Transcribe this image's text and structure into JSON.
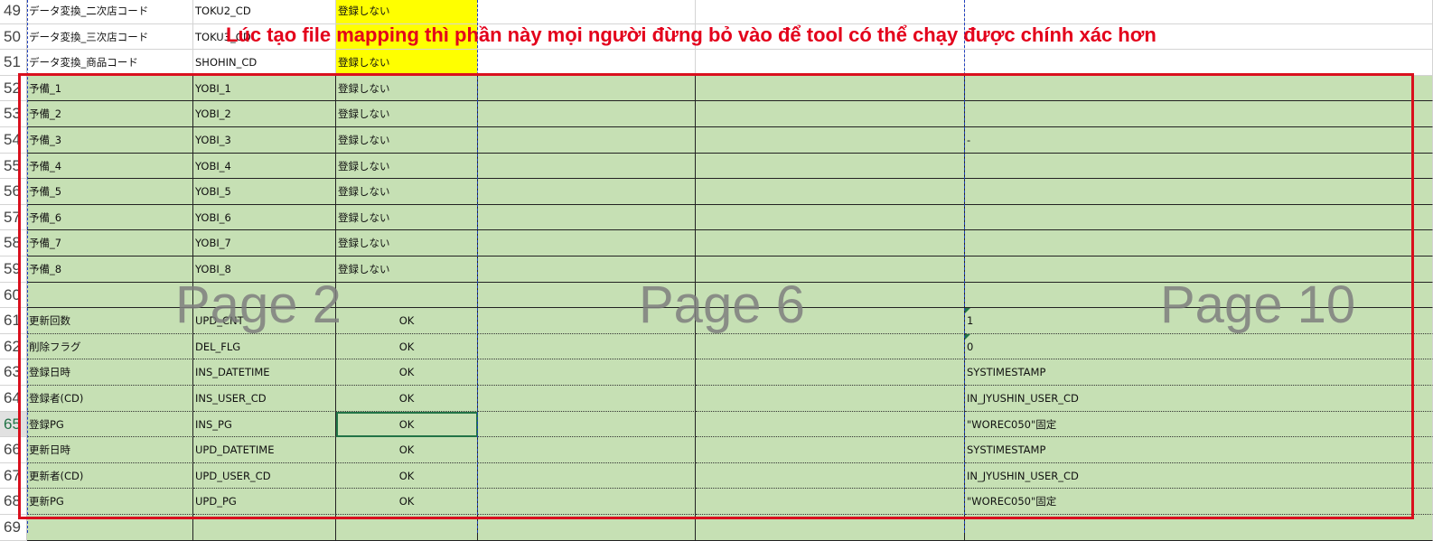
{
  "rows": [
    {
      "num": "49",
      "c1": "データ変換_二次店コード",
      "c2": "TOKU2_CD",
      "c3": "登録しない",
      "c6": "",
      "type": "white",
      "c3yellow": true
    },
    {
      "num": "50",
      "c1": "データ変換_三次店コード",
      "c2": "TOKU3_CD",
      "c3": "",
      "c6": "",
      "type": "white",
      "c3yellow": true
    },
    {
      "num": "51",
      "c1": "データ変換_商品コード",
      "c2": "SHOHIN_CD",
      "c3": "登録しない",
      "c6": "",
      "type": "white",
      "c3yellow": true
    },
    {
      "num": "52",
      "c1": "予備_1",
      "c2": "YOBI_1",
      "c3": "登録しない",
      "c6": "",
      "type": "green"
    },
    {
      "num": "53",
      "c1": "予備_2",
      "c2": "YOBI_2",
      "c3": "登録しない",
      "c6": "",
      "type": "green"
    },
    {
      "num": "54",
      "c1": "予備_3",
      "c2": "YOBI_3",
      "c3": "登録しない",
      "c6": "-",
      "type": "green"
    },
    {
      "num": "55",
      "c1": "予備_4",
      "c2": "YOBI_4",
      "c3": "登録しない",
      "c6": "",
      "type": "green"
    },
    {
      "num": "56",
      "c1": "予備_5",
      "c2": "YOBI_5",
      "c3": "登録しない",
      "c6": "",
      "type": "green"
    },
    {
      "num": "57",
      "c1": "予備_6",
      "c2": "YOBI_6",
      "c3": "登録しない",
      "c6": "",
      "type": "green"
    },
    {
      "num": "58",
      "c1": "予備_7",
      "c2": "YOBI_7",
      "c3": "登録しない",
      "c6": "",
      "type": "green"
    },
    {
      "num": "59",
      "c1": "予備_8",
      "c2": "YOBI_8",
      "c3": "登録しない",
      "c6": "",
      "type": "green"
    },
    {
      "num": "60",
      "c1": "",
      "c2": "",
      "c3": "",
      "c6": "",
      "type": "green"
    },
    {
      "num": "61",
      "c1": "更新回数",
      "c2": "UPD_CNT",
      "c3": "OK",
      "c6": "1",
      "type": "green",
      "dotted": true,
      "tick": true
    },
    {
      "num": "62",
      "c1": "削除フラグ",
      "c2": "DEL_FLG",
      "c3": "OK",
      "c6": "0",
      "type": "green",
      "dotted": true,
      "tick": true
    },
    {
      "num": "63",
      "c1": "登録日時",
      "c2": "INS_DATETIME",
      "c3": "OK",
      "c6": "SYSTIMESTAMP",
      "type": "green",
      "dotted": true
    },
    {
      "num": "64",
      "c1": "登録者(CD)",
      "c2": "INS_USER_CD",
      "c3": "OK",
      "c6": "IN_JYUSHIN_USER_CD",
      "type": "green",
      "dotted": true
    },
    {
      "num": "65",
      "c1": "登録PG",
      "c2": "INS_PG",
      "c3": "OK",
      "c6": "\"WOREC050\"固定",
      "type": "green",
      "dotted": true,
      "selected": true
    },
    {
      "num": "66",
      "c1": "更新日時",
      "c2": "UPD_DATETIME",
      "c3": "OK",
      "c6": "SYSTIMESTAMP",
      "type": "green",
      "dotted": true
    },
    {
      "num": "67",
      "c1": "更新者(CD)",
      "c2": "UPD_USER_CD",
      "c3": "OK",
      "c6": "IN_JYUSHIN_USER_CD",
      "type": "green",
      "dotted": true
    },
    {
      "num": "68",
      "c1": "更新PG",
      "c2": "UPD_PG",
      "c3": "OK",
      "c6": "\"WOREC050\"固定",
      "type": "green",
      "dotted": true
    },
    {
      "num": "69",
      "c1": "",
      "c2": "",
      "c3": "",
      "c6": "",
      "type": "green"
    }
  ],
  "watermarks": {
    "page2": "Page 2",
    "page6": "Page 6",
    "page10": "Page 10"
  },
  "annotation": "Lúc tạo file mapping thì phần này mọi người đừng bỏ vào để tool có thể chạy được chính xác hơn",
  "colors": {
    "green": "#c6e0b4",
    "yellow": "#ffff00",
    "annotation": "#e3001b",
    "pagebreak": "#1f3fbf",
    "selection": "#217346"
  }
}
